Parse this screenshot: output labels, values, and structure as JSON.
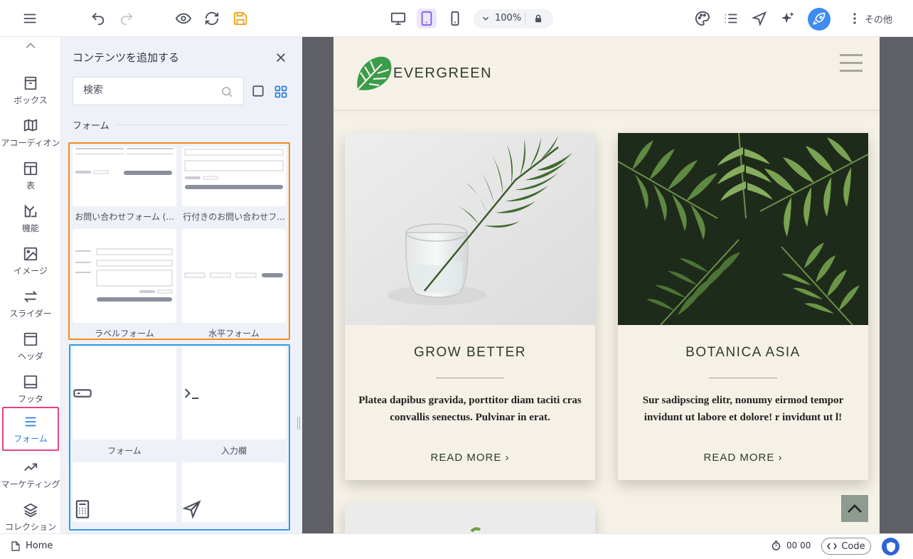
{
  "toolbar": {
    "zoom": "100%",
    "more_label": "その他",
    "icons": [
      "menu-icon",
      "undo-icon",
      "redo-icon",
      "preview-eye-icon",
      "refresh-icon",
      "save-icon",
      "desktop-icon",
      "tablet-icon",
      "mobile-icon",
      "chevron-down-icon",
      "lock-icon",
      "palette-icon",
      "list-icon",
      "send-icon",
      "ai-sparkle-icon",
      "rocket-icon",
      "more-vertical-icon"
    ],
    "accent": "#7b5ce0",
    "publish_color": "#3f8cf0"
  },
  "rail": {
    "items": [
      {
        "label": "ボックス",
        "icon": "archive-box-icon"
      },
      {
        "label": "アコーディオン",
        "icon": "accordion-icon"
      },
      {
        "label": "表",
        "icon": "table-icon"
      },
      {
        "label": "機能",
        "icon": "features-icon"
      },
      {
        "label": "イメージ",
        "icon": "image-icon"
      },
      {
        "label": "スライダー",
        "icon": "slider-icon"
      },
      {
        "label": "ヘッダ",
        "icon": "header-icon"
      },
      {
        "label": "フッタ",
        "icon": "footer-icon"
      },
      {
        "label": "フォーム",
        "icon": "form-icon",
        "active": true
      },
      {
        "label": "マーケティング",
        "icon": "trending-icon"
      },
      {
        "label": "コレクション",
        "icon": "layers-icon"
      }
    ],
    "active_border": "#e8417e"
  },
  "panel": {
    "title": "コンテンツを追加する",
    "search_placeholder": "検索",
    "section": "フォーム",
    "orange_group": {
      "color": "#f5891f",
      "tiles": [
        {
          "label": "お問い合わせフォーム (..."
        },
        {
          "label": "行付きのお問い合わせフ..."
        },
        {
          "label": "ラベルフォーム"
        },
        {
          "label": "水平フォーム"
        }
      ]
    },
    "blue_group": {
      "color": "#2f9be8",
      "tiles": [
        {
          "label": "フォーム",
          "icon": "input-field-icon"
        },
        {
          "label": "入力欄",
          "icon": "terminal-icon"
        },
        {
          "label": "",
          "icon": "calculator-icon"
        },
        {
          "label": "",
          "icon": "send-icon"
        }
      ]
    }
  },
  "site": {
    "logo_text": "EVERGREEN",
    "cards": [
      {
        "title": "GROW BETTER",
        "text": "Platea dapibus gravida, porttitor diam taciti cras convallis senectus. Pulvinar in erat.",
        "more": "READ MORE ›"
      },
      {
        "title": "BOTANICA ASIA",
        "text": "Sur sadipscing elitr, nonumy eirmod tempor invidunt ut labore et dolore! r invidunt ut l!",
        "more": "READ MORE ›"
      }
    ]
  },
  "status": {
    "home": "Home",
    "timer": "00 00",
    "code": "Code"
  }
}
